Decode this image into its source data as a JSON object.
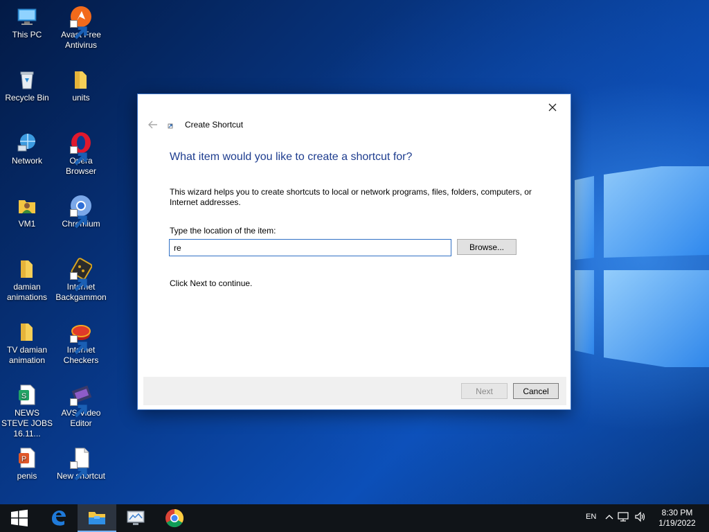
{
  "desktop": {
    "icons": [
      {
        "label": "This PC",
        "icon": "computer-icon"
      },
      {
        "label": "Avast Free Antivirus",
        "icon": "avast-icon"
      },
      {
        "label": "Recycle Bin",
        "icon": "recycle-bin-icon"
      },
      {
        "label": "units",
        "icon": "folder-icon"
      },
      {
        "label": "Network",
        "icon": "network-icon"
      },
      {
        "label": "Opera Browser",
        "icon": "opera-icon"
      },
      {
        "label": "VM1",
        "icon": "user-folder-icon"
      },
      {
        "label": "Chromium",
        "icon": "chromium-icon"
      },
      {
        "label": "damian animations",
        "icon": "folder-icon"
      },
      {
        "label": "Internet Backgammon",
        "icon": "backgammon-icon"
      },
      {
        "label": "TV damian animation",
        "icon": "folder-icon"
      },
      {
        "label": "Internet Checkers",
        "icon": "checkers-icon"
      },
      {
        "label": "NEWS STEVE JOBS 16.11...",
        "icon": "spreadsheet-icon"
      },
      {
        "label": "AVS Video Editor",
        "icon": "video-editor-icon"
      },
      {
        "label": "penis",
        "icon": "presentation-icon"
      },
      {
        "label": "New shortcut",
        "icon": "shortcut-file-icon"
      }
    ]
  },
  "dialog": {
    "title": "Create Shortcut",
    "heading": "What item would you like to create a shortcut for?",
    "description": "This wizard helps you to create shortcuts to local or network programs, files, folders, computers, or Internet addresses.",
    "location_label": "Type the location of the item:",
    "location_value": "re",
    "browse_label": "Browse...",
    "continue_text": "Click Next to continue.",
    "next_label": "Next",
    "cancel_label": "Cancel"
  },
  "taskbar": {
    "language": "EN",
    "time": "8:30 PM",
    "date": "1/19/2022"
  },
  "colors": {
    "heading_blue": "#1e3d8f",
    "input_border": "#2f6fc4",
    "taskbar_bg": "#101418"
  }
}
